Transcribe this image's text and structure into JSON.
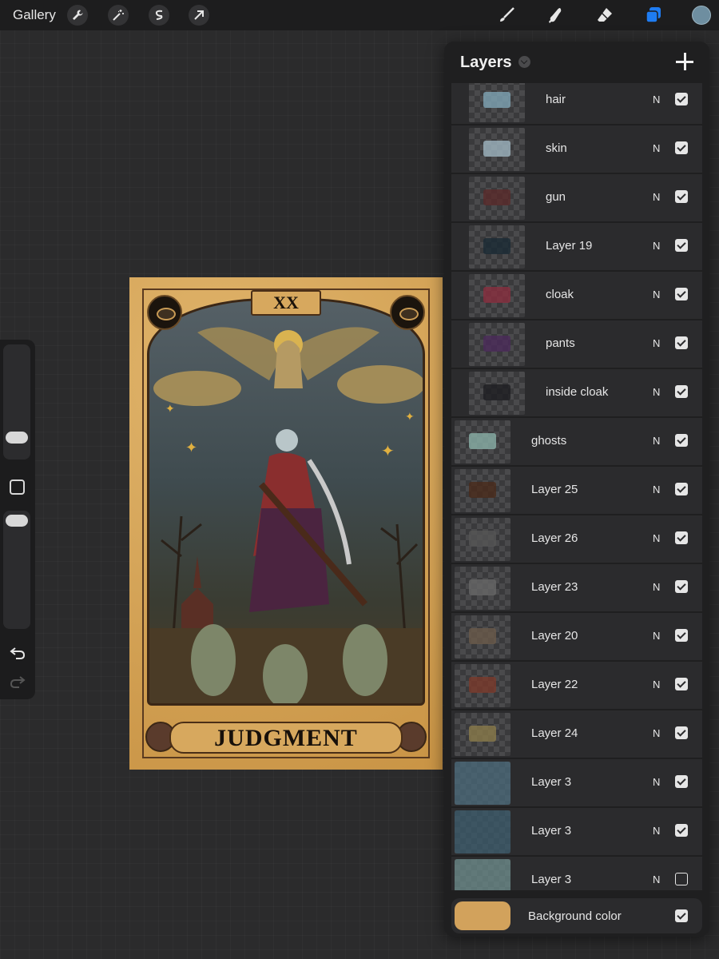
{
  "toolbar": {
    "gallery_label": "Gallery",
    "left_tools": [
      "wrench-icon",
      "magic-wand-icon",
      "selection-icon",
      "transform-arrow-icon"
    ],
    "right_tools": [
      "brush-icon",
      "smudge-icon",
      "eraser-icon",
      "layers-icon"
    ],
    "active_color": "#6e8ea0",
    "layers_active_color": "#1e7cf2"
  },
  "canvas": {
    "card_roman_numeral": "XX",
    "card_title": "JUDGMENT",
    "card_color": "#d6a55a"
  },
  "layers_panel": {
    "title": "Layers",
    "layers": [
      {
        "name": "hair",
        "blend": "N",
        "visible": true,
        "child": true
      },
      {
        "name": "skin",
        "blend": "N",
        "visible": true,
        "child": true
      },
      {
        "name": "gun",
        "blend": "N",
        "visible": true,
        "child": true
      },
      {
        "name": "Layer 19",
        "blend": "N",
        "visible": true,
        "child": true
      },
      {
        "name": "cloak",
        "blend": "N",
        "visible": true,
        "child": true
      },
      {
        "name": "pants",
        "blend": "N",
        "visible": true,
        "child": true
      },
      {
        "name": "inside cloak",
        "blend": "N",
        "visible": true,
        "child": true
      },
      {
        "name": "ghosts",
        "blend": "N",
        "visible": true,
        "child": false
      },
      {
        "name": "Layer 25",
        "blend": "N",
        "visible": true,
        "child": false
      },
      {
        "name": "Layer 26",
        "blend": "N",
        "visible": true,
        "child": false
      },
      {
        "name": "Layer 23",
        "blend": "N",
        "visible": true,
        "child": false
      },
      {
        "name": "Layer 20",
        "blend": "N",
        "visible": true,
        "child": false
      },
      {
        "name": "Layer 22",
        "blend": "N",
        "visible": true,
        "child": false
      },
      {
        "name": "Layer 24",
        "blend": "N",
        "visible": true,
        "child": false
      },
      {
        "name": "Layer 3",
        "blend": "N",
        "visible": true,
        "child": false
      },
      {
        "name": "Layer 3",
        "blend": "N",
        "visible": true,
        "child": false
      },
      {
        "name": "Layer 3",
        "blend": "N",
        "visible": false,
        "child": false
      }
    ],
    "background": {
      "label": "Background color",
      "color": "#d2a25c",
      "visible": true
    }
  }
}
